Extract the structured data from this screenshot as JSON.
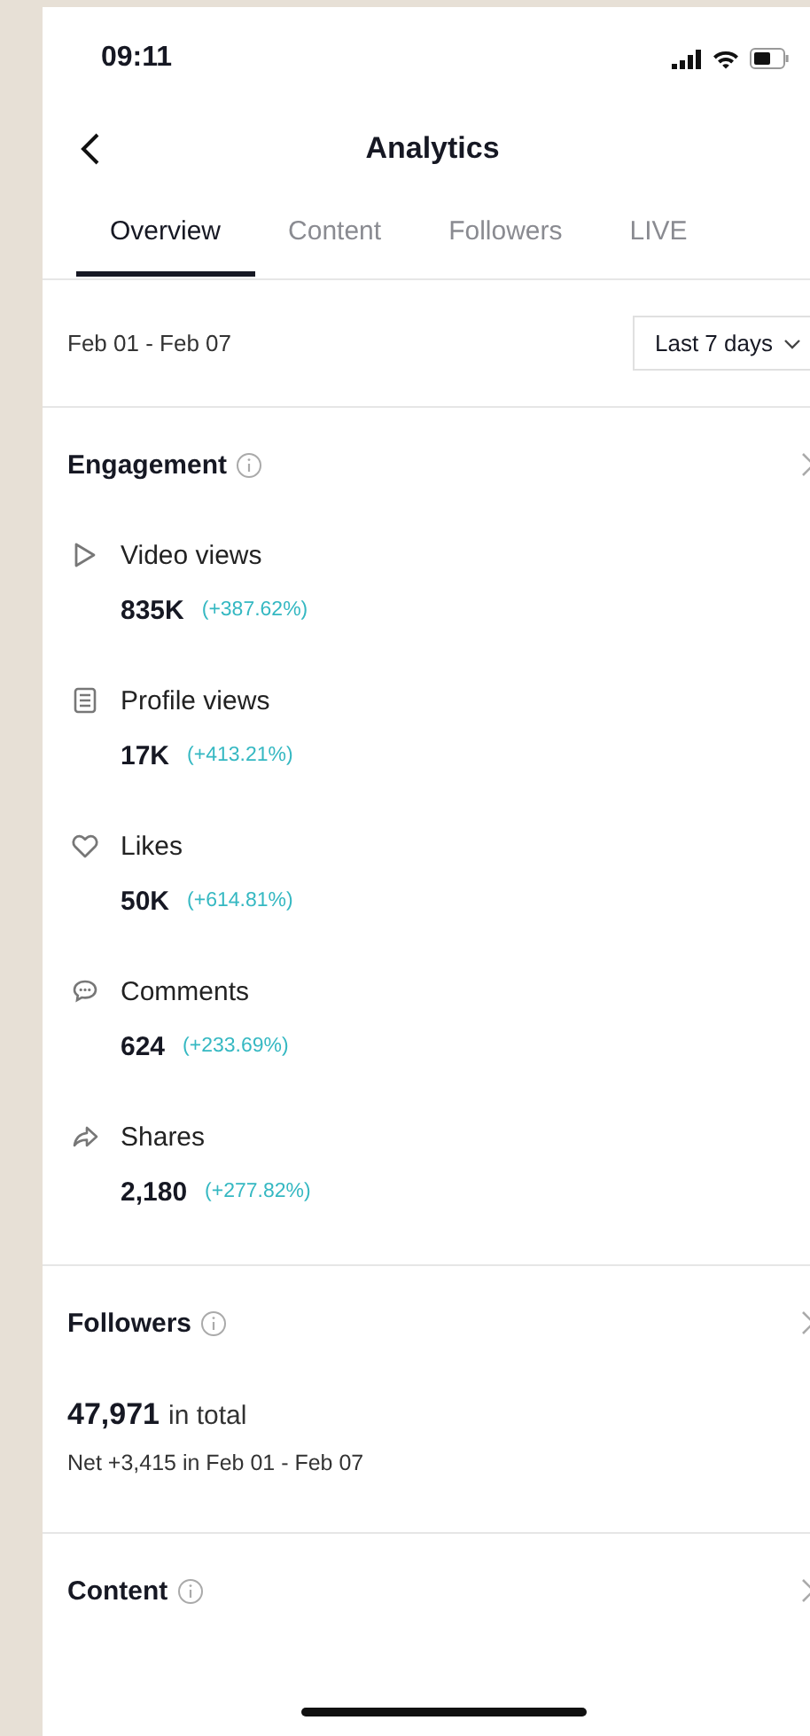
{
  "status_bar": {
    "time": "09:11"
  },
  "header": {
    "title": "Analytics"
  },
  "tabs": [
    {
      "label": "Overview",
      "selected": true
    },
    {
      "label": "Content",
      "selected": false
    },
    {
      "label": "Followers",
      "selected": false
    },
    {
      "label": "LIVE",
      "selected": false
    }
  ],
  "date_range": {
    "label": "Feb 01 - Feb 07",
    "dropdown": "Last 7 days"
  },
  "sections": [
    {
      "kind": "metrics",
      "title": "Engagement",
      "metrics": [
        {
          "kind": "play",
          "label": "Video views",
          "value": "835K",
          "change": "(+387.62%)"
        },
        {
          "kind": "profile",
          "label": "Profile views",
          "value": "17K",
          "change": "(+413.21%)"
        },
        {
          "kind": "heart",
          "label": "Likes",
          "value": "50K",
          "change": "(+614.81%)"
        },
        {
          "kind": "comment",
          "label": "Comments",
          "value": "624",
          "change": "(+233.69%)"
        },
        {
          "kind": "share",
          "label": "Shares",
          "value": "2,180",
          "change": "(+277.82%)"
        }
      ]
    },
    {
      "kind": "total",
      "title": "Followers",
      "total": "47,971",
      "total_suffix": "in total",
      "net": "Net +3,415 in Feb 01 - Feb 07"
    },
    {
      "kind": "plain",
      "title": "Content"
    }
  ]
}
